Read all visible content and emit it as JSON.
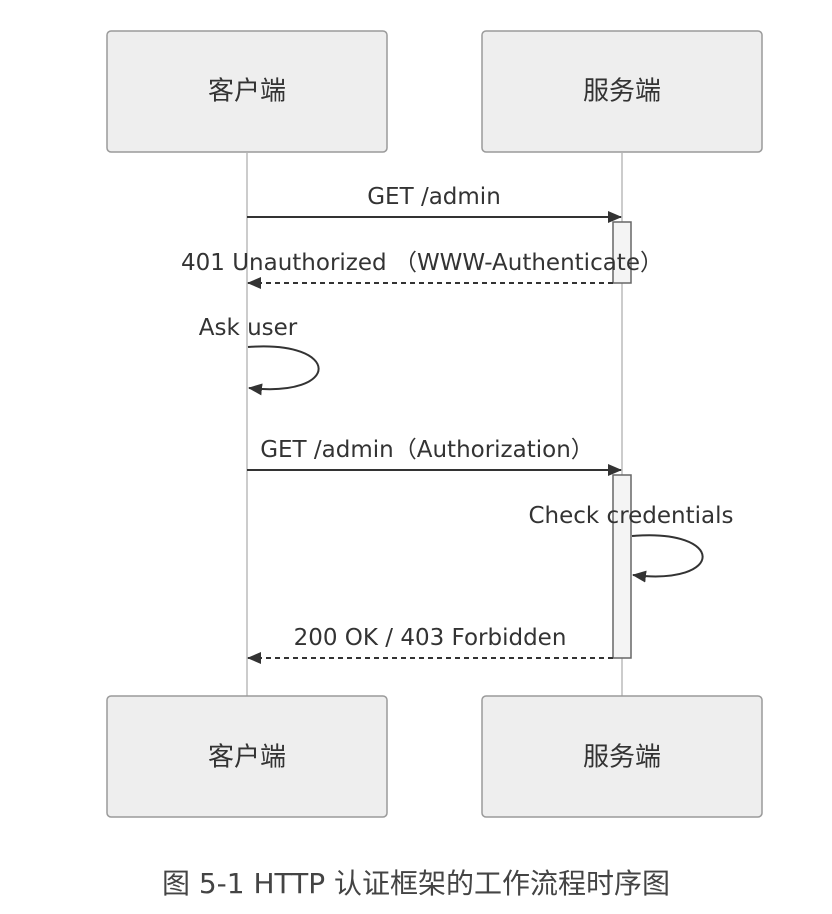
{
  "diagram": {
    "participants": {
      "client": "客户端",
      "server": "服务端"
    },
    "messages": {
      "m1": "GET /admin",
      "m2": "401 Unauthorized （WWW-Authenticate）",
      "m3": "Ask user",
      "m4": "GET /admin（Authorization）",
      "m5": "Check credentials",
      "m6": "200 OK / 403 Forbidden"
    }
  },
  "caption": "图 5-1 HTTP 认证框架的工作流程时序图"
}
